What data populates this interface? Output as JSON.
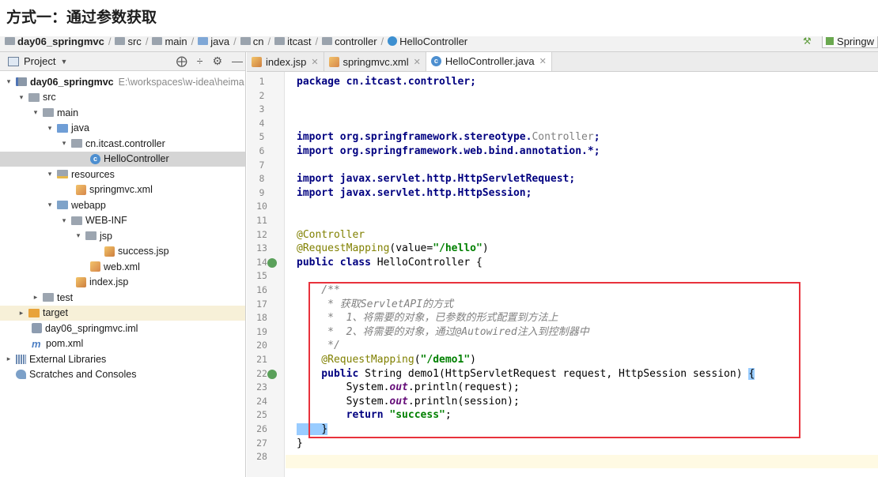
{
  "heading": "方式一：通过参数获取",
  "breadcrumb": {
    "items": [
      "day06_springmvc",
      "src",
      "main",
      "java",
      "cn",
      "itcast",
      "controller",
      "HelloController"
    ],
    "run_config": "Springw"
  },
  "project_panel": {
    "title": "Project",
    "tree": [
      {
        "label": "day06_springmvc",
        "path": "E:\\workspaces\\w-idea\\heima"
      },
      {
        "label": "src"
      },
      {
        "label": "main"
      },
      {
        "label": "java"
      },
      {
        "label": "cn.itcast.controller"
      },
      {
        "label": "HelloController"
      },
      {
        "label": "resources"
      },
      {
        "label": "springmvc.xml"
      },
      {
        "label": "webapp"
      },
      {
        "label": "WEB-INF"
      },
      {
        "label": "jsp"
      },
      {
        "label": "success.jsp"
      },
      {
        "label": "web.xml"
      },
      {
        "label": "index.jsp"
      },
      {
        "label": "test"
      },
      {
        "label": "target"
      },
      {
        "label": "day06_springmvc.iml"
      },
      {
        "label": "pom.xml"
      },
      {
        "label": "External Libraries"
      },
      {
        "label": "Scratches and Consoles"
      }
    ]
  },
  "tabs": [
    "index.jsp",
    "springmvc.xml",
    "HelloController.java"
  ],
  "line_numbers": [
    "1",
    "2",
    "3",
    "4",
    "5",
    "6",
    "7",
    "8",
    "9",
    "10",
    "11",
    "12",
    "13",
    "14",
    "15",
    "16",
    "17",
    "18",
    "19",
    "20",
    "21",
    "22",
    "23",
    "24",
    "25",
    "26",
    "27",
    "28"
  ],
  "code": {
    "l1_kw": "package ",
    "l1_rest": "cn.itcast.controller;",
    "l5_kw": "import ",
    "l5_a": "org.springframework.stereotype.",
    "l5_b": "Controller",
    "l5_c": ";",
    "l6_kw": "import ",
    "l6_a": "org.springframework.web.bind.annotation.*;",
    "l8_kw": "import ",
    "l8_a": "javax.servlet.http.HttpServletRequest;",
    "l9_kw": "import ",
    "l9_a": "javax.servlet.http.HttpSession;",
    "l12": "@Controller",
    "l13_an": "@RequestMapping",
    "l13_a": "(value=",
    "l13_str": "\"/hello\"",
    "l13_b": ")",
    "l14_kw": "public class ",
    "l14_a": "HelloController {",
    "l16": "    /**",
    "l17": "     * 获取ServletAPI的方式",
    "l18": "     *  1、将需要的对象，已参数的形式配置到方法上",
    "l19": "     *  2、将需要的对象，通过@Autowired注入到控制器中",
    "l20": "     */",
    "l21_an": "    @RequestMapping",
    "l21_a": "(",
    "l21_str": "\"/demo1\"",
    "l21_b": ")",
    "l22_kw": "    public ",
    "l22_a": "String demo1(HttpServletRequest request, HttpSession session) ",
    "l22_br": "{",
    "l23_a": "        System.",
    "l23_f": "out",
    "l23_b": ".println(request);",
    "l24_a": "        System.",
    "l24_f": "out",
    "l24_b": ".println(session);",
    "l25_kw": "        return ",
    "l25_str": "\"success\"",
    "l25_b": ";",
    "l26_br": "    }",
    "l27": "}"
  }
}
